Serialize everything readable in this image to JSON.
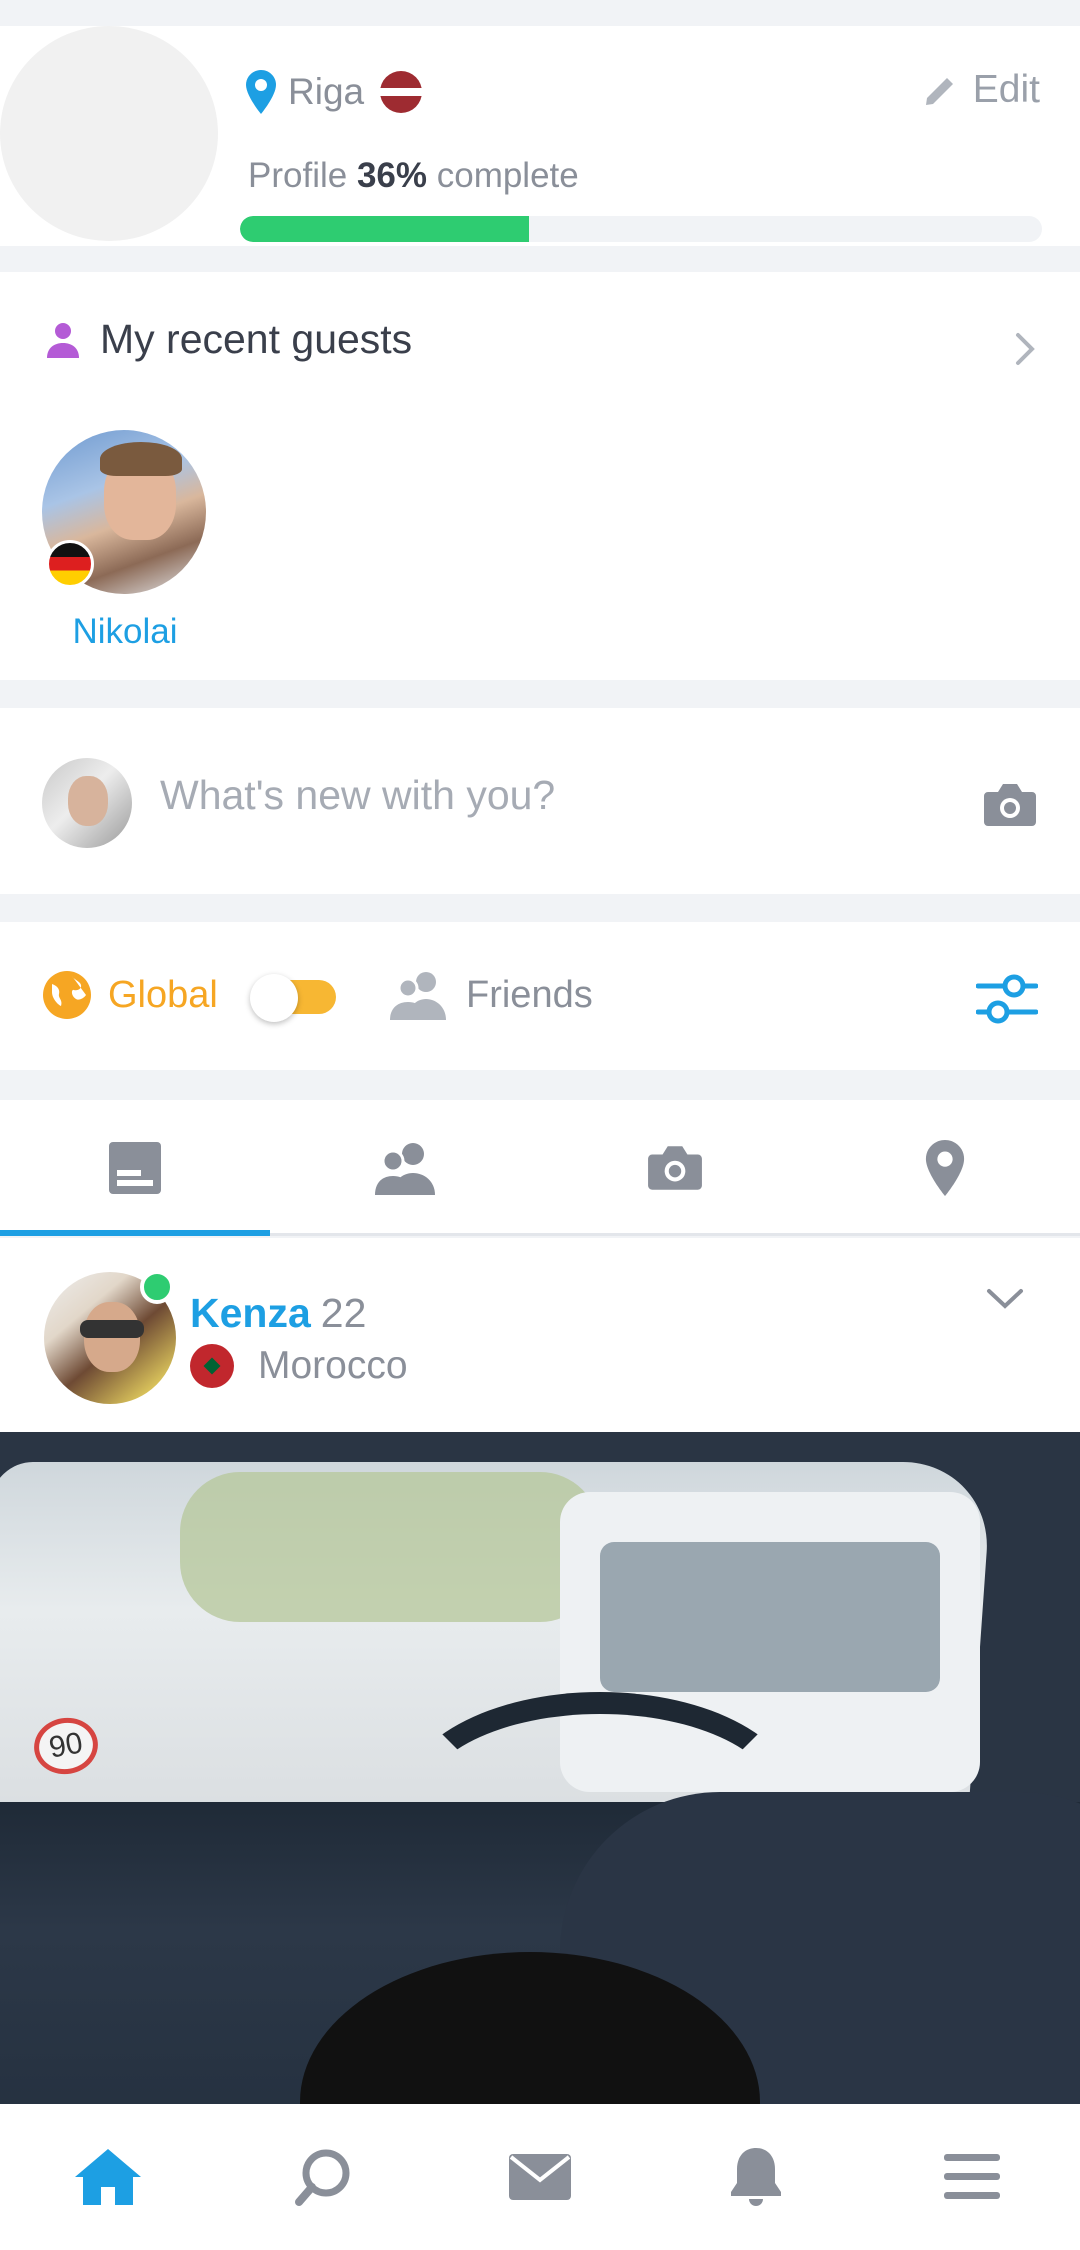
{
  "profile": {
    "location": "Riga",
    "edit_label": "Edit",
    "completion_prefix": "Profile ",
    "completion_percent": "36%",
    "completion_suffix": " complete",
    "progress_fraction": 0.36
  },
  "guests": {
    "title": "My recent guests",
    "items": [
      {
        "name": "Nikolai",
        "flag": "germany"
      }
    ]
  },
  "composer": {
    "placeholder": "What's new with you?"
  },
  "filter": {
    "global_label": "Global",
    "friends_label": "Friends"
  },
  "tabs": [
    {
      "name": "feed",
      "icon": "feed-icon",
      "active": true
    },
    {
      "name": "people",
      "icon": "people-icon"
    },
    {
      "name": "photos",
      "icon": "camera-icon"
    },
    {
      "name": "places",
      "icon": "location-pin-icon"
    }
  ],
  "post": {
    "name": "Kenza",
    "age": "22",
    "country": "Morocco",
    "online": true,
    "image_sign_text": "90"
  },
  "bottom_nav": [
    {
      "name": "home",
      "icon": "home-icon",
      "active": true
    },
    {
      "name": "search",
      "icon": "search-icon"
    },
    {
      "name": "messages",
      "icon": "mail-icon"
    },
    {
      "name": "notifications",
      "icon": "bell-icon"
    },
    {
      "name": "menu",
      "icon": "menu-icon"
    }
  ],
  "colors": {
    "accent": "#1d9fe3",
    "progress": "#2ecc71",
    "global": "#f6a623",
    "guests_icon": "#b45bd6",
    "muted": "#8a8f99"
  }
}
